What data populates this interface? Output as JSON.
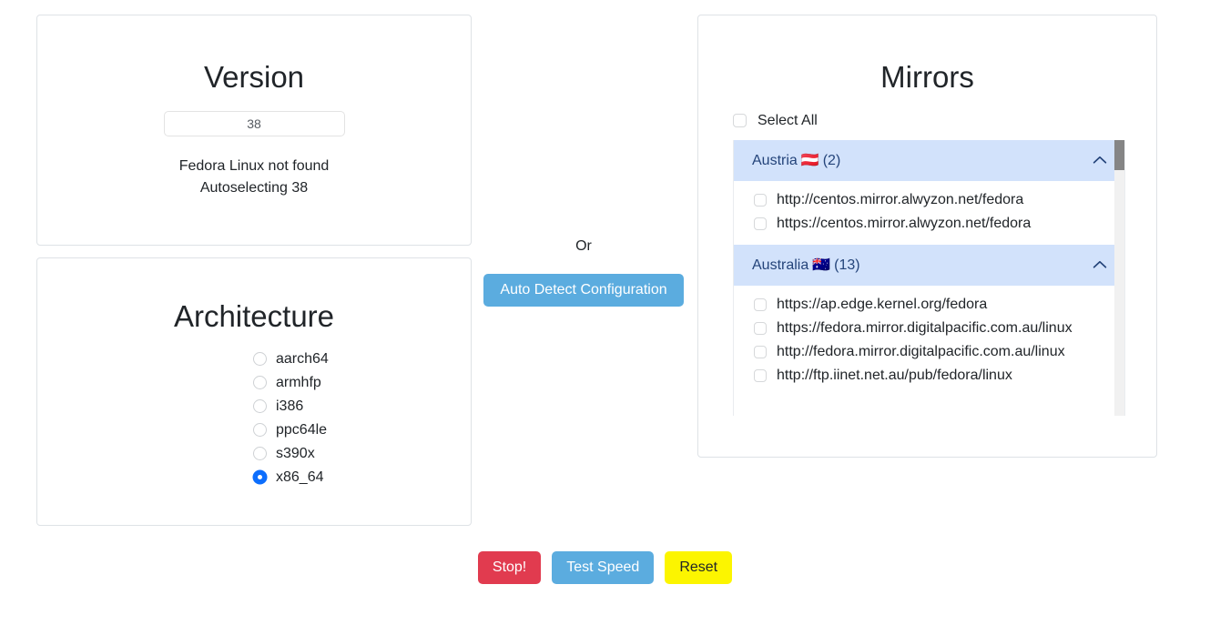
{
  "version_panel": {
    "title": "Version",
    "input_value": "38",
    "input_placeholder": "38",
    "status_line_1": "Fedora Linux not found",
    "status_line_2": "Autoselecting 38"
  },
  "architecture_panel": {
    "title": "Architecture",
    "options": [
      {
        "label": "aarch64",
        "selected": false
      },
      {
        "label": "armhfp",
        "selected": false
      },
      {
        "label": "i386",
        "selected": false
      },
      {
        "label": "ppc64le",
        "selected": false
      },
      {
        "label": "s390x",
        "selected": false
      },
      {
        "label": "x86_64",
        "selected": true
      }
    ]
  },
  "center": {
    "or_label": "Or",
    "auto_detect_label": "Auto Detect Configuration"
  },
  "mirrors_panel": {
    "title": "Mirrors",
    "select_all_label": "Select All",
    "select_all_checked": false,
    "groups": [
      {
        "country": "Austria",
        "flag": "🇦🇹",
        "count_label": "(2)",
        "expanded": true,
        "chevron": "chevron-up-icon",
        "mirrors": [
          {
            "url": "http://centos.mirror.alwyzon.net/fedora",
            "checked": false
          },
          {
            "url": "https://centos.mirror.alwyzon.net/fedora",
            "checked": false
          }
        ]
      },
      {
        "country": "Australia",
        "flag": "🇦🇺",
        "count_label": "(13)",
        "expanded": true,
        "chevron": "chevron-up-icon",
        "mirrors": [
          {
            "url": "https://ap.edge.kernel.org/fedora",
            "checked": false
          },
          {
            "url": "https://fedora.mirror.digitalpacific.com.au/linux",
            "checked": false
          },
          {
            "url": "http://fedora.mirror.digitalpacific.com.au/linux",
            "checked": false
          },
          {
            "url": "http://ftp.iinet.net.au/pub/fedora/linux",
            "checked": false
          }
        ]
      }
    ]
  },
  "footer": {
    "stop_label": "Stop!",
    "test_speed_label": "Test Speed",
    "reset_label": "Reset"
  },
  "colors": {
    "accent_blue": "#5bacdf",
    "radio_selected": "#0d6efd",
    "group_header_bg": "#d2e2fb",
    "group_header_text": "#24447a",
    "stop_red": "#e13b4f",
    "reset_yellow": "#fcf500",
    "scrollbar_thumb": "#858585"
  }
}
